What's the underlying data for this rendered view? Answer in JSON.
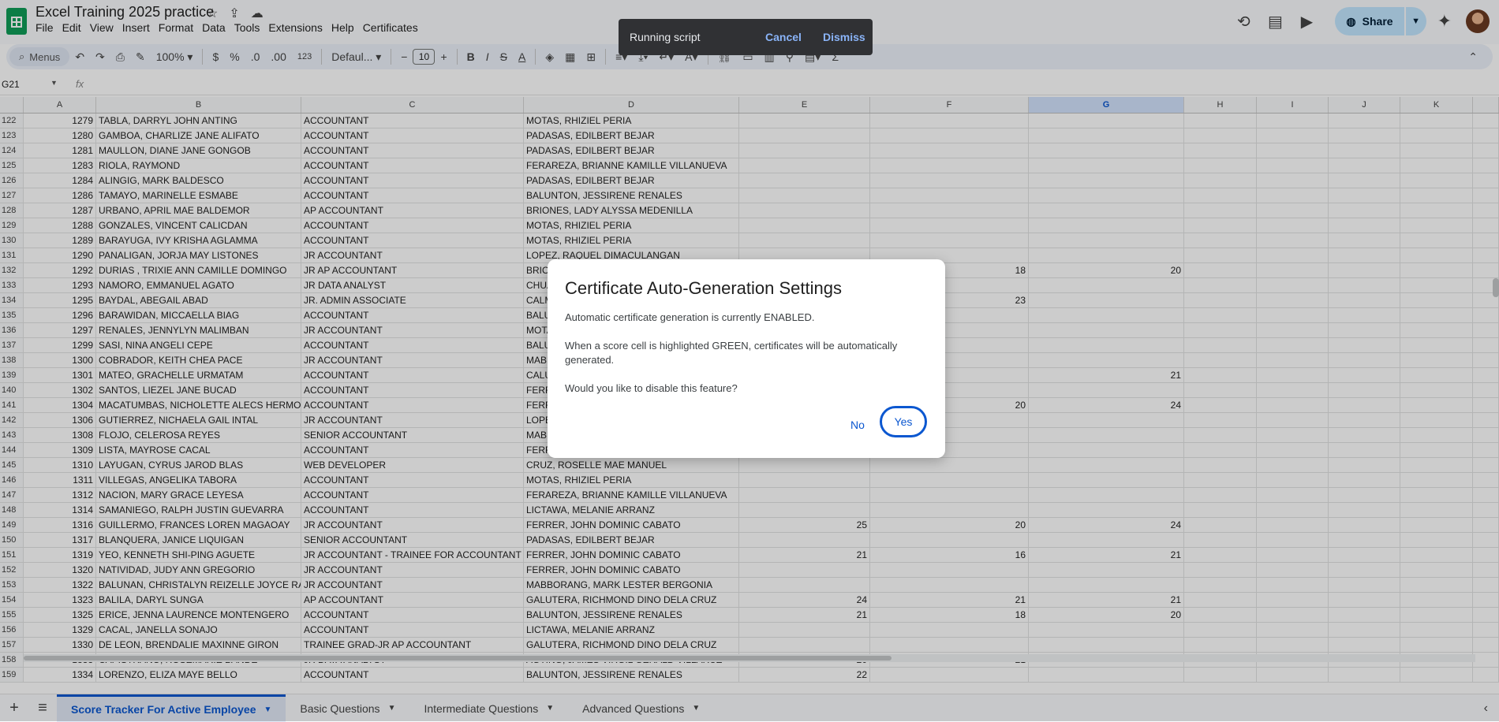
{
  "app": {
    "title": "Excel Training 2025 practice",
    "menu": [
      "File",
      "Edit",
      "View",
      "Insert",
      "Format",
      "Data",
      "Tools",
      "Extensions",
      "Help",
      "Certificates"
    ],
    "share_label": "Share"
  },
  "toolbar": {
    "menus_label": "Menus",
    "zoom": "100%",
    "currency": "$",
    "percent": "%",
    "dec_decrease": ".0",
    "dec_increase": ".00",
    "number_format": "123",
    "font_name": "Defaul...",
    "font_size": "10",
    "bold": "B",
    "italic": "I",
    "strike": "S",
    "text_color": "A"
  },
  "formula_bar": {
    "name_box": "G21",
    "fx": "fx"
  },
  "columns": [
    "A",
    "B",
    "C",
    "D",
    "E",
    "F",
    "G",
    "H",
    "I",
    "J",
    "K"
  ],
  "selected_column": "G",
  "rows": [
    {
      "n": "122",
      "a": "1279",
      "b": "TABLA, DARRYL JOHN ANTING",
      "c": "ACCOUNTANT",
      "d": "MOTAS, RHIZIEL PERIA",
      "e": "",
      "f": "",
      "g": ""
    },
    {
      "n": "123",
      "a": "1280",
      "b": "GAMBOA, CHARLIZE JANE  ALIFATO",
      "c": "ACCOUNTANT",
      "d": "PADASAS, EDILBERT BEJAR",
      "e": "",
      "f": "",
      "g": ""
    },
    {
      "n": "124",
      "a": "1281",
      "b": "MAULLON, DIANE JANE GONGOB",
      "c": "ACCOUNTANT",
      "d": "PADASAS, EDILBERT BEJAR",
      "e": "",
      "f": "",
      "g": ""
    },
    {
      "n": "125",
      "a": "1283",
      "b": "RIOLA, RAYMOND",
      "c": "ACCOUNTANT",
      "d": "FERAREZA, BRIANNE KAMILLE VILLANUEVA",
      "e": "",
      "f": "",
      "g": ""
    },
    {
      "n": "126",
      "a": "1284",
      "b": "ALINGIG, MARK  BALDESCO",
      "c": "ACCOUNTANT",
      "d": "PADASAS, EDILBERT BEJAR",
      "e": "",
      "f": "",
      "g": ""
    },
    {
      "n": "127",
      "a": "1286",
      "b": "TAMAYO, MARINELLE ESMABE",
      "c": "ACCOUNTANT",
      "d": "BALUNTON, JESSIRENE RENALES",
      "e": "",
      "f": "",
      "g": ""
    },
    {
      "n": "128",
      "a": "1287",
      "b": "URBANO, APRIL MAE BALDEMOR",
      "c": "AP ACCOUNTANT",
      "d": "BRIONES, LADY ALYSSA MEDENILLA",
      "e": "",
      "f": "",
      "g": ""
    },
    {
      "n": "129",
      "a": "1288",
      "b": "GONZALES, VINCENT CALICDAN",
      "c": "ACCOUNTANT",
      "d": "MOTAS, RHIZIEL PERIA",
      "e": "",
      "f": "",
      "g": ""
    },
    {
      "n": "130",
      "a": "1289",
      "b": "BARAYUGA, IVY KRISHA AGLAMMA",
      "c": "ACCOUNTANT",
      "d": "MOTAS, RHIZIEL PERIA",
      "e": "",
      "f": "",
      "g": ""
    },
    {
      "n": "131",
      "a": "1290",
      "b": "PANALIGAN, JORJA MAY LISTONES",
      "c": "JR ACCOUNTANT",
      "d": "LOPEZ, RAQUEL DIMACULANGAN",
      "e": "",
      "f": "",
      "g": ""
    },
    {
      "n": "132",
      "a": "1292",
      "b": "DURIAS , TRIXIE ANN CAMILLE DOMINGO",
      "c": "JR AP ACCOUNTANT",
      "d": "BRIONES",
      "e": "",
      "f": "18",
      "g": "20"
    },
    {
      "n": "133",
      "a": "1293",
      "b": "NAMORO, EMMANUEL  AGATO",
      "c": "JR DATA ANALYST",
      "d": "CHUA",
      "e": "",
      "f": "",
      "g": ""
    },
    {
      "n": "134",
      "a": "1295",
      "b": "BAYDAL, ABEGAIL ABAD",
      "c": "JR. ADMIN ASSOCIATE",
      "d": "CALM",
      "e": "",
      "f": "23",
      "g": ""
    },
    {
      "n": "135",
      "a": "1296",
      "b": "BARAWIDAN, MICCAELLA BIAG",
      "c": "ACCOUNTANT",
      "d": "BALU",
      "e": "",
      "f": "",
      "g": ""
    },
    {
      "n": "136",
      "a": "1297",
      "b": "RENALES, JENNYLYN MALIMBAN",
      "c": "JR ACCOUNTANT",
      "d": "MOTA",
      "e": "",
      "f": "",
      "g": ""
    },
    {
      "n": "137",
      "a": "1299",
      "b": "SASI, NINA ANGELI CEPE",
      "c": "ACCOUNTANT",
      "d": "BALU",
      "e": "",
      "f": "",
      "g": ""
    },
    {
      "n": "138",
      "a": "1300",
      "b": "COBRADOR, KEITH CHEA PACE",
      "c": "JR ACCOUNTANT",
      "d": "MABB",
      "e": "",
      "f": "",
      "g": ""
    },
    {
      "n": "139",
      "a": "1301",
      "b": "MATEO, GRACHELLE  URMATAM",
      "c": "ACCOUNTANT",
      "d": "CALU",
      "e": "",
      "f": "",
      "g": "21"
    },
    {
      "n": "140",
      "a": "1302",
      "b": "SANTOS, LIEZEL JANE BUCAD",
      "c": "ACCOUNTANT",
      "d": "FERR",
      "e": "",
      "f": "",
      "g": ""
    },
    {
      "n": "141",
      "a": "1304",
      "b": "MACATUMBAS, NICHOLETTE ALECS HERMOSO",
      "c": "ACCOUNTANT",
      "d": "FERR",
      "e": "",
      "f": "20",
      "g": "24"
    },
    {
      "n": "142",
      "a": "1306",
      "b": "GUTIERREZ, NICHAELA GAIL INTAL",
      "c": "JR ACCOUNTANT",
      "d": "LOPE",
      "e": "",
      "f": "",
      "g": ""
    },
    {
      "n": "143",
      "a": "1308",
      "b": "FLOJO, CELEROSA REYES",
      "c": "SENIOR ACCOUNTANT",
      "d": "MABB",
      "e": "",
      "f": "",
      "g": ""
    },
    {
      "n": "144",
      "a": "1309",
      "b": "LISTA, MAYROSE CACAL",
      "c": "ACCOUNTANT",
      "d": "FERR",
      "e": "",
      "f": "",
      "g": ""
    },
    {
      "n": "145",
      "a": "1310",
      "b": "LAYUGAN, CYRUS JAROD BLAS",
      "c": "WEB DEVELOPER",
      "d": "CRUZ, ROSELLE MAE MANUEL",
      "e": "",
      "f": "",
      "g": ""
    },
    {
      "n": "146",
      "a": "1311",
      "b": "VILLEGAS, ANGELIKA TABORA",
      "c": "ACCOUNTANT",
      "d": "MOTAS, RHIZIEL PERIA",
      "e": "",
      "f": "",
      "g": ""
    },
    {
      "n": "147",
      "a": "1312",
      "b": "NACION, MARY GRACE LEYESA",
      "c": "ACCOUNTANT",
      "d": "FERAREZA, BRIANNE KAMILLE VILLANUEVA",
      "e": "",
      "f": "",
      "g": ""
    },
    {
      "n": "148",
      "a": "1314",
      "b": "SAMANIEGO, RALPH JUSTIN GUEVARRA",
      "c": "ACCOUNTANT",
      "d": "LICTAWA, MELANIE ARRANZ",
      "e": "",
      "f": "",
      "g": ""
    },
    {
      "n": "149",
      "a": "1316",
      "b": "GUILLERMO, FRANCES LOREN MAGAOAY",
      "c": "JR ACCOUNTANT",
      "d": "FERRER, JOHN DOMINIC CABATO",
      "e": "25",
      "f": "20",
      "g": "24"
    },
    {
      "n": "150",
      "a": "1317",
      "b": "BLANQUERA, JANICE LIQUIGAN",
      "c": "SENIOR ACCOUNTANT",
      "d": "PADASAS, EDILBERT BEJAR",
      "e": "",
      "f": "",
      "g": ""
    },
    {
      "n": "151",
      "a": "1319",
      "b": "YEO, KENNETH SHI-PING AGUETE",
      "c": "JR ACCOUNTANT - TRAINEE FOR ACCOUNTANT",
      "d": "FERRER, JOHN DOMINIC CABATO",
      "e": "21",
      "f": "16",
      "g": "21"
    },
    {
      "n": "152",
      "a": "1320",
      "b": "NATIVIDAD, JUDY ANN GREGORIO",
      "c": "JR ACCOUNTANT",
      "d": "FERRER, JOHN DOMINIC CABATO",
      "e": "",
      "f": "",
      "g": ""
    },
    {
      "n": "153",
      "a": "1322",
      "b": "BALUNAN, CHRISTALYN REIZELLE JOYCE RAMOS",
      "c": "JR ACCOUNTANT",
      "d": "MABBORANG, MARK LESTER BERGONIA",
      "e": "",
      "f": "",
      "g": ""
    },
    {
      "n": "154",
      "a": "1323",
      "b": "BALILA, DARYL SUNGA",
      "c": "AP ACCOUNTANT",
      "d": "GALUTERA, RICHMOND DINO DELA CRUZ",
      "e": "24",
      "f": "21",
      "g": "21"
    },
    {
      "n": "155",
      "a": "1325",
      "b": "ERICE, JENNA LAURENCE MONTENGERO",
      "c": "ACCOUNTANT",
      "d": "BALUNTON, JESSIRENE RENALES",
      "e": "21",
      "f": "18",
      "g": "20"
    },
    {
      "n": "156",
      "a": "1329",
      "b": "CACAL, JANELLA SONAJO",
      "c": "ACCOUNTANT",
      "d": "LICTAWA, MELANIE ARRANZ",
      "e": "",
      "f": "",
      "g": ""
    },
    {
      "n": "157",
      "a": "1330",
      "b": "DE LEON, BRENDALIE MAXINNE GIRON",
      "c": "TRAINEE GRAD-JR AP ACCOUNTANT",
      "d": "GALUTERA, RICHMOND DINO DELA CRUZ",
      "e": "",
      "f": "",
      "g": ""
    },
    {
      "n": "158",
      "a": "1333",
      "b": "CAPISTRANO, ROSEMARIE BANDE",
      "c": "JR DATA ANALYST",
      "d": "AGTING, JAMES VIRGIL GERALD VILLARUZ",
      "e": "20",
      "f": "21",
      "g": ""
    },
    {
      "n": "159",
      "a": "1334",
      "b": "LORENZO, ELIZA MAYE BELLO",
      "c": "ACCOUNTANT",
      "d": "BALUNTON, JESSIRENE RENALES",
      "e": "22",
      "f": "",
      "g": ""
    }
  ],
  "sheet_tabs": [
    "Score Tracker For Active Employee",
    "Basic Questions",
    "Intermediate Questions",
    "Advanced Questions"
  ],
  "snackbar": {
    "text": "Running script",
    "cancel": "Cancel",
    "dismiss": "Dismiss"
  },
  "dialog": {
    "title": "Certificate Auto-Generation Settings",
    "line1": "Automatic certificate generation is currently ENABLED.",
    "line2": "When a score cell is highlighted GREEN, certificates will be automatically generated.",
    "line3": "Would you like to disable this feature?",
    "no": "No",
    "yes": "Yes"
  },
  "colors": {
    "accent": "#0b57d0",
    "share_bg": "#c2e7ff",
    "sheets_green": "#0f9d58"
  }
}
